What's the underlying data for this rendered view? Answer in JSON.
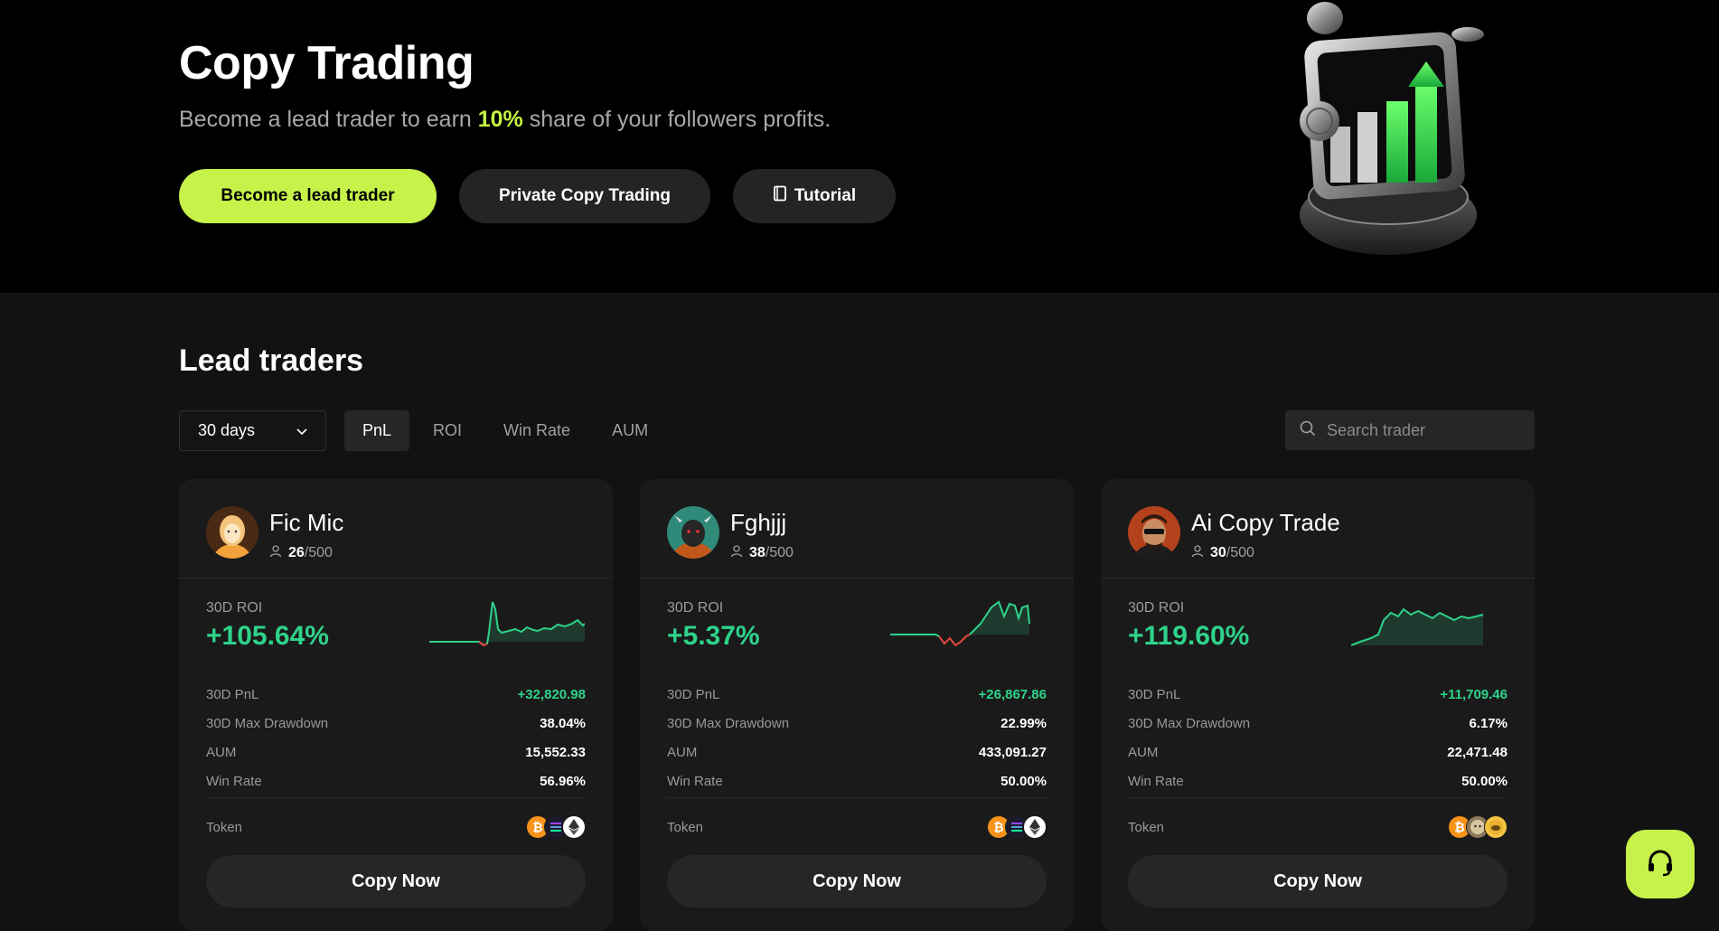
{
  "hero": {
    "title": "Copy Trading",
    "subtitle_pre": "Become a lead trader to earn ",
    "subtitle_accent": "10%",
    "subtitle_post": " share of your followers profits.",
    "buttons": {
      "lead": "Become a lead trader",
      "private": "Private Copy Trading",
      "tutorial": "Tutorial"
    }
  },
  "section": {
    "title": "Lead traders"
  },
  "filters": {
    "period": "30 days",
    "tabs": [
      "PnL",
      "ROI",
      "Win Rate",
      "AUM"
    ],
    "active_tab": "PnL",
    "search_placeholder": "Search trader"
  },
  "colors": {
    "accent": "#c6f24a",
    "positive": "#2ed38a",
    "negative": "#e5493a"
  },
  "traders": [
    {
      "name": "Fic Mic",
      "followers": "26",
      "max_followers": "/500",
      "roi_label": "30D ROI",
      "roi": "+105.64%",
      "pnl_label": "30D PnL",
      "pnl": "+32,820.98",
      "dd_label": "30D Max Drawdown",
      "dd": "38.04%",
      "aum_label": "AUM",
      "aum": "15,552.33",
      "wr_label": "Win Rate",
      "wr": "56.96%",
      "token_label": "Token",
      "tokens": [
        "btc-icon",
        "sol-icon",
        "eth-icon"
      ],
      "copy": "Copy Now"
    },
    {
      "name": "Fghjjj",
      "followers": "38",
      "max_followers": "/500",
      "roi_label": "30D ROI",
      "roi": "+5.37%",
      "pnl_label": "30D PnL",
      "pnl": "+26,867.86",
      "dd_label": "30D Max Drawdown",
      "dd": "22.99%",
      "aum_label": "AUM",
      "aum": "433,091.27",
      "wr_label": "Win Rate",
      "wr": "50.00%",
      "token_label": "Token",
      "tokens": [
        "btc-icon",
        "sol-icon",
        "eth-icon"
      ],
      "copy": "Copy Now"
    },
    {
      "name": "Ai Copy Trade",
      "followers": "30",
      "max_followers": "/500",
      "roi_label": "30D ROI",
      "roi": "+119.60%",
      "pnl_label": "30D PnL",
      "pnl": "+11,709.46",
      "dd_label": "30D Max Drawdown",
      "dd": "6.17%",
      "aum_label": "AUM",
      "aum": "22,471.48",
      "wr_label": "Win Rate",
      "wr": "50.00%",
      "token_label": "Token",
      "tokens": [
        "btc-icon",
        "meme-icon",
        "pepe-icon"
      ],
      "copy": "Copy Now"
    }
  ]
}
